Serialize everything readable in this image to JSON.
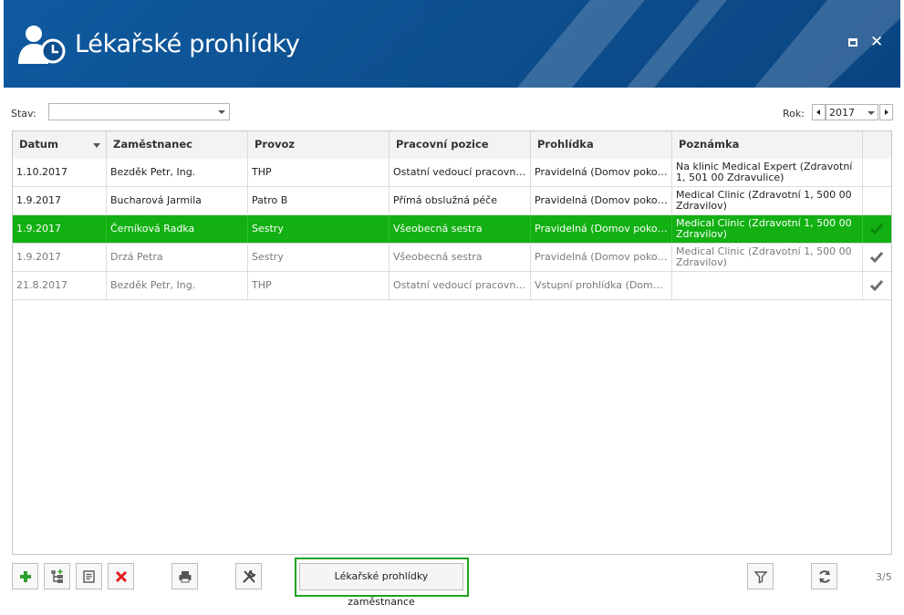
{
  "window": {
    "title": "Lékařské prohlídky",
    "maximize_icon": "maximize-icon",
    "close_icon": "close-icon",
    "accent": "#0d4e8d"
  },
  "filters": {
    "stav_label": "Stav:",
    "stav_value": "",
    "rok_label": "Rok:",
    "rok_value": "2017"
  },
  "grid": {
    "columns": [
      "Datum",
      "Zaměstnanec",
      "Provoz",
      "Pracovní pozice",
      "Prohlídka",
      "Poznámka",
      ""
    ],
    "rows": [
      {
        "datum": "1.10.2017",
        "zamestnanec": "Bezděk Petr, Ing.",
        "provoz": "THP",
        "pozice": "Ostatní vedoucí pracovníci",
        "prohlidka": "Pravidelná (Domov pokojné…",
        "poznamka": "Na klinic Medical Expert (Zdravotní 1, 501 00 Zdravulice)",
        "checked": false,
        "state": "normal"
      },
      {
        "datum": "1.9.2017",
        "zamestnanec": "Bucharová Jarmila",
        "provoz": "Patro B",
        "pozice": "Přímá obslužná péče",
        "prohlidka": "Pravidelná (Domov pokojné…",
        "poznamka": "Medical Clinic (Zdravotní 1, 500 00 Zdravilov)",
        "checked": false,
        "state": "normal"
      },
      {
        "datum": "1.9.2017",
        "zamestnanec": "Černíková Radka",
        "provoz": "Sestry",
        "pozice": "Všeobecná sestra",
        "prohlidka": "Pravidelná (Domov pokojné…",
        "poznamka": "Medical Clinic (Zdravotní 1, 500 00 Zdravilov)",
        "checked": true,
        "state": "selected"
      },
      {
        "datum": "1.9.2017",
        "zamestnanec": "Drzá Petra",
        "provoz": "Sestry",
        "pozice": "Všeobecná sestra",
        "prohlidka": "Pravidelná (Domov pokojné…",
        "poznamka": "Medical Clinic (Zdravotní 1, 500 00 Zdravilov)",
        "checked": true,
        "state": "inactive"
      },
      {
        "datum": "21.8.2017",
        "zamestnanec": "Bezděk Petr, Ing.",
        "provoz": "THP",
        "pozice": "Ostatní vedoucí pracovníci",
        "prohlidka": "Vstupní prohlídka (Domov…",
        "poznamka": "",
        "checked": true,
        "state": "inactive"
      }
    ],
    "selected_color": "#12b012"
  },
  "toolbar": {
    "add_icon": "plus-icon",
    "tree_icon": "tree-add-icon",
    "edit_icon": "edit-document-icon",
    "delete_icon": "delete-icon",
    "print_icon": "print-icon",
    "tools_icon": "tools-icon",
    "main_button_label": "Lékařské prohlídky zaměstnance",
    "filter_icon": "filter-icon",
    "refresh_icon": "refresh-icon",
    "page_indicator": "3/5"
  }
}
